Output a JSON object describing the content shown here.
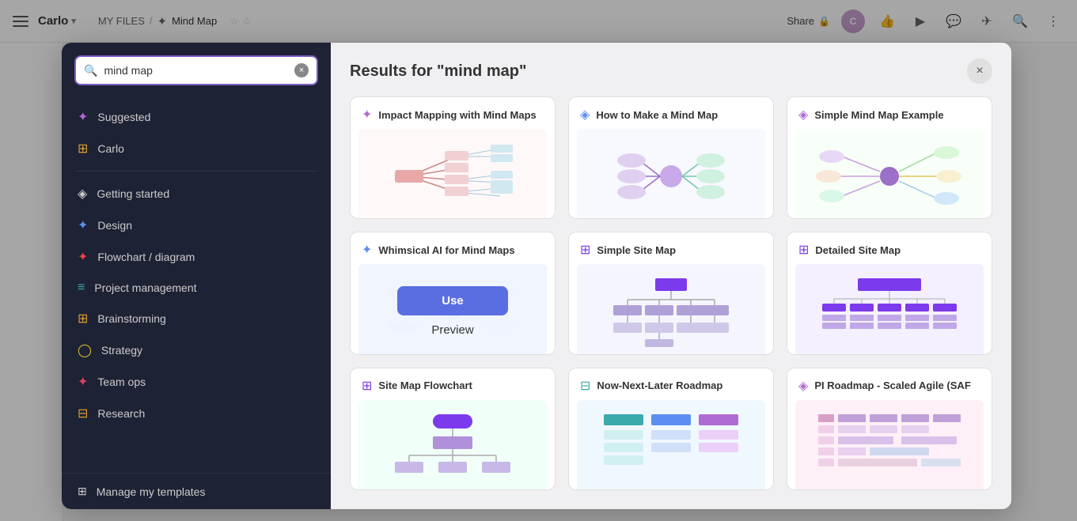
{
  "topBar": {
    "menuIcon": "menu-icon",
    "brand": "Carlo",
    "brandChevron": "▾",
    "breadcrumb": {
      "myFiles": "MY FILES",
      "separator": "/",
      "pageIcon": "✦",
      "pageName": "Mind Map",
      "star1": "☆",
      "star2": "☆"
    },
    "share": "Share",
    "lockIcon": "🔒",
    "avatarInitials": "C",
    "icons": [
      "👍",
      "▶",
      "💬",
      "✈",
      "🔍",
      "⋮"
    ]
  },
  "leftPanel": {
    "searchPlaceholder": "mind map",
    "searchValue": "mind map",
    "clearBtn": "×",
    "menuItems": [
      {
        "id": "suggested",
        "icon": "✦",
        "label": "Suggested",
        "color": "#b06ad4"
      },
      {
        "id": "carlo",
        "icon": "⊞",
        "label": "Carlo",
        "color": "#e0a030"
      },
      {
        "id": "getting-started",
        "icon": "◈",
        "label": "Getting started",
        "color": "#333"
      },
      {
        "id": "design",
        "icon": "✦",
        "label": "Design",
        "color": "#5b8ef0"
      },
      {
        "id": "flowchart",
        "icon": "✦",
        "label": "Flowchart / diagram",
        "color": "#c44"
      },
      {
        "id": "project-mgmt",
        "icon": "≡",
        "label": "Project management",
        "color": "#3baaaa"
      },
      {
        "id": "brainstorming",
        "icon": "⊞",
        "label": "Brainstorming",
        "color": "#e0a030"
      },
      {
        "id": "strategy",
        "icon": "◯",
        "label": "Strategy",
        "color": "#e0c030"
      },
      {
        "id": "team-ops",
        "icon": "✦",
        "label": "Team ops",
        "color": "#e04060"
      },
      {
        "id": "research",
        "icon": "⊟",
        "label": "Research",
        "color": "#e0a030"
      }
    ],
    "manageTemplates": {
      "icon": "⊞",
      "label": "Manage my templates"
    }
  },
  "rightPanel": {
    "title": "Results for \"mind map\"",
    "closeBtn": "×",
    "cards": [
      {
        "id": "impact-mapping",
        "icon": "✦",
        "iconColor": "#b06ad4",
        "title": "Impact Mapping with Mind Maps",
        "previewType": "impact"
      },
      {
        "id": "how-to-mind-map",
        "icon": "◈",
        "iconColor": "#5b8ef0",
        "title": "How to Make a Mind Map",
        "previewType": "howto"
      },
      {
        "id": "simple-mind-map",
        "icon": "◈",
        "iconColor": "#b06ad4",
        "title": "Simple Mind Map Example",
        "previewType": "simple"
      },
      {
        "id": "whimsical-ai",
        "icon": "✦",
        "iconColor": "#5b8ef0",
        "title": "Whimsical AI for Mind Maps",
        "previewType": "whimsical",
        "hovered": true,
        "useLabel": "Use",
        "previewLabel": "Preview"
      },
      {
        "id": "simple-site-map",
        "icon": "⊞",
        "iconColor": "#7c3aed",
        "title": "Simple Site Map",
        "previewType": "siteMap"
      },
      {
        "id": "detailed-site-map",
        "icon": "⊞",
        "iconColor": "#7c3aed",
        "title": "Detailed Site Map",
        "previewType": "detailed"
      },
      {
        "id": "site-map-flowchart",
        "icon": "⊞",
        "iconColor": "#7c3aed",
        "title": "Site Map Flowchart",
        "previewType": "flowchart"
      },
      {
        "id": "now-next-later",
        "icon": "⊟",
        "iconColor": "#3baaaa",
        "title": "Now-Next-Later Roadmap",
        "previewType": "roadmap"
      },
      {
        "id": "pi-roadmap",
        "icon": "◈",
        "iconColor": "#b06ad4",
        "title": "PI Roadmap - Scaled Agile (SAF",
        "previewType": "pi"
      }
    ]
  }
}
